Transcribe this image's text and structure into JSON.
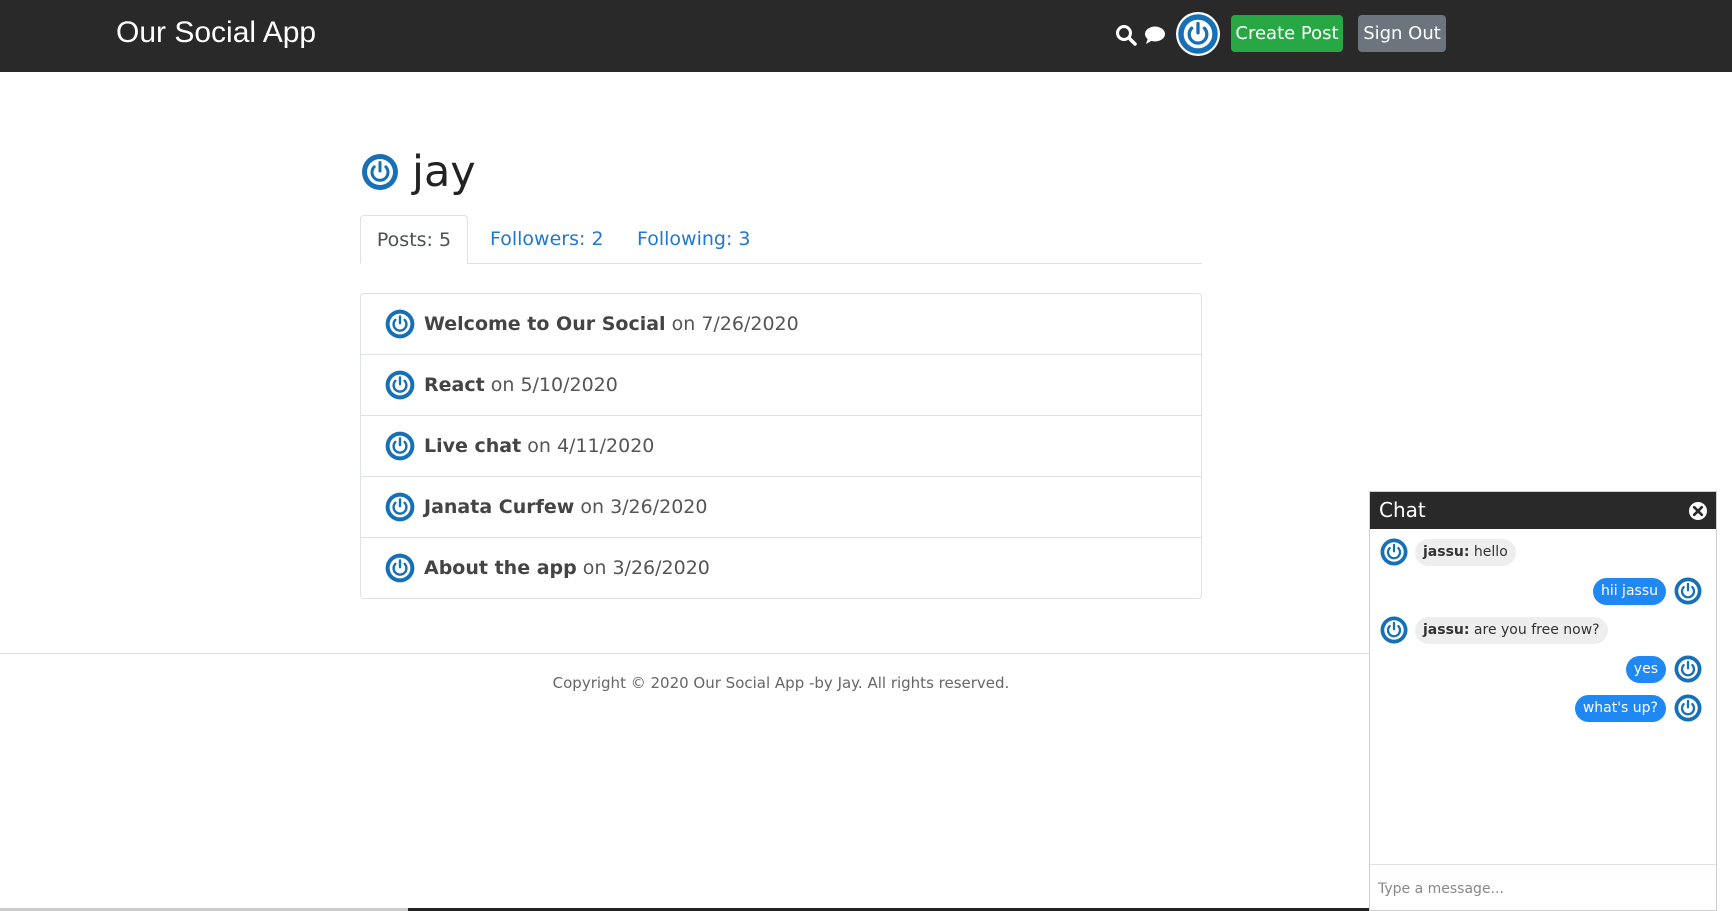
{
  "header": {
    "brand": "Our Social App",
    "create_post_label": "Create Post",
    "sign_out_label": "Sign Out",
    "icons": [
      "search-icon",
      "chat-icon",
      "power-avatar"
    ]
  },
  "profile": {
    "username": "jay",
    "tabs": [
      {
        "label": "Posts: 5",
        "active": true
      },
      {
        "label": "Followers: 2",
        "active": false
      },
      {
        "label": "Following: 3",
        "active": false
      }
    ],
    "posts": [
      {
        "title": "Welcome to Our Social",
        "date": "on 7/26/2020"
      },
      {
        "title": "React",
        "date": "on 5/10/2020"
      },
      {
        "title": "Live chat",
        "date": "on 4/11/2020"
      },
      {
        "title": "Janata Curfew",
        "date": "on 3/26/2020"
      },
      {
        "title": "About the app",
        "date": "on 3/26/2020"
      }
    ]
  },
  "footer": {
    "text": "Copyright © 2020 Our Social App -by Jay. All rights reserved."
  },
  "chat": {
    "title": "Chat",
    "messages": [
      {
        "direction": "in",
        "author": "jassu:",
        "text": " hello"
      },
      {
        "direction": "out",
        "text": "hii jassu"
      },
      {
        "direction": "in",
        "author": "jassu:",
        "text": " are you free now?"
      },
      {
        "direction": "out",
        "text": "yes"
      },
      {
        "direction": "out",
        "text": "what's up?"
      }
    ],
    "input_placeholder": "Type a message..."
  },
  "colors": {
    "header_bg": "#292929",
    "avatar_blue": "#1570b8",
    "create_post": "#28a745",
    "sign_out": "#6c757d",
    "link": "#1f78d1",
    "chat_bubble_out": "#1f88f2"
  }
}
